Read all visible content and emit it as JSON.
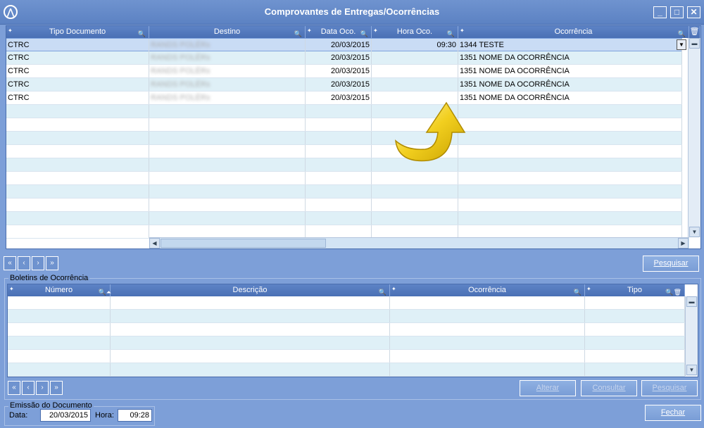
{
  "window": {
    "title": "Comprovantes de Entregas/Ocorrências",
    "icon": "app-logo-icon",
    "controls": {
      "minimize": "_",
      "maximize": "□",
      "close": "✕"
    }
  },
  "grid1": {
    "columns": [
      "Tipo Documento",
      "Destino",
      "Data Oco.",
      "Hora Oco.",
      "Ocorrência"
    ],
    "rows": [
      {
        "tipo": "CTRC",
        "destino": "RANDS POLÉRs",
        "data": "20/03/2015",
        "hora": "09:30",
        "ocorrencia": "1344 TESTE",
        "selected": true
      },
      {
        "tipo": "CTRC",
        "destino": "RANDS POLÉRs",
        "data": "20/03/2015",
        "hora": "",
        "ocorrencia": "1351 NOME DA OCORRÊNCIA"
      },
      {
        "tipo": "CTRC",
        "destino": "RANDS POLÉRs",
        "data": "20/03/2015",
        "hora": "",
        "ocorrencia": "1351 NOME DA OCORRÊNCIA"
      },
      {
        "tipo": "CTRC",
        "destino": "RANDS POLÉRs",
        "data": "20/03/2015",
        "hora": "",
        "ocorrencia": "1351 NOME DA OCORRÊNCIA"
      },
      {
        "tipo": "CTRC",
        "destino": "RANDS POLÉRs",
        "data": "20/03/2015",
        "hora": "",
        "ocorrencia": "1351 NOME DA OCORRÊNCIA"
      }
    ]
  },
  "buttons": {
    "pesquisar1": "Pesquisar",
    "alterar": "Alterar",
    "consultar": "Consultar",
    "pesquisar2": "Pesquisar",
    "fechar": "Fechar"
  },
  "boletins": {
    "label": "Boletins de Ocorrência",
    "columns": [
      "Número",
      "Descrição",
      "Ocorrência",
      "Tipo"
    ]
  },
  "emissao": {
    "label": "Emissão do Documento",
    "data_label": "Data:",
    "data_value": "20/03/2015",
    "hora_label": "Hora:",
    "hora_value": "09:28"
  },
  "colors": {
    "titlebar": "#5c82c3",
    "background": "#7d9fd8",
    "alt_row": "#dff0f7",
    "arrow": "#f2cf1f"
  }
}
